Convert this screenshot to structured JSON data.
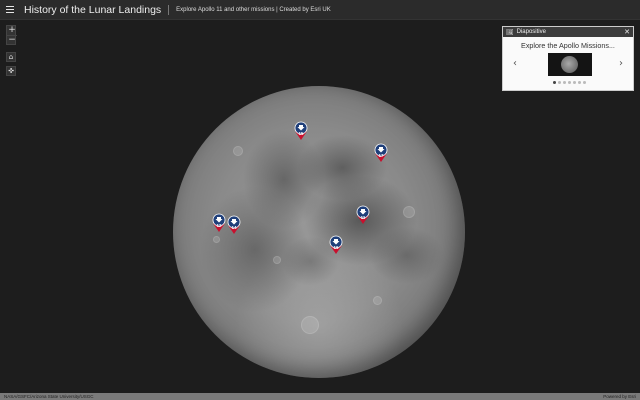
{
  "header": {
    "title": "History of the Lunar Landings",
    "subtitle": "Explore Apollo 11 and other missions | Created by Esri UK"
  },
  "map": {
    "zoom_in": "+",
    "zoom_out": "−",
    "home_icon": "⌂",
    "locate_icon": "✜",
    "pins": [
      {
        "label": "15"
      },
      {
        "label": "17"
      },
      {
        "label": "12"
      },
      {
        "label": "14"
      },
      {
        "label": "11"
      },
      {
        "label": "16"
      }
    ]
  },
  "slideshow": {
    "header_icon": "🖼",
    "header_title": "Diapositive",
    "close": "✕",
    "title": "Explore the Apollo Missions...",
    "prev": "‹",
    "next": "›",
    "dots": [
      true,
      false,
      false,
      false,
      false,
      false,
      false
    ]
  },
  "footer": {
    "attribution": "NASA/GSFC/Arizona State University/USGC",
    "powered_by": "Powered by Esri"
  },
  "colors": {
    "pin_blue": "#1f3f7a",
    "pin_red": "#c8102e",
    "header_bg": "#2b2b2b"
  }
}
